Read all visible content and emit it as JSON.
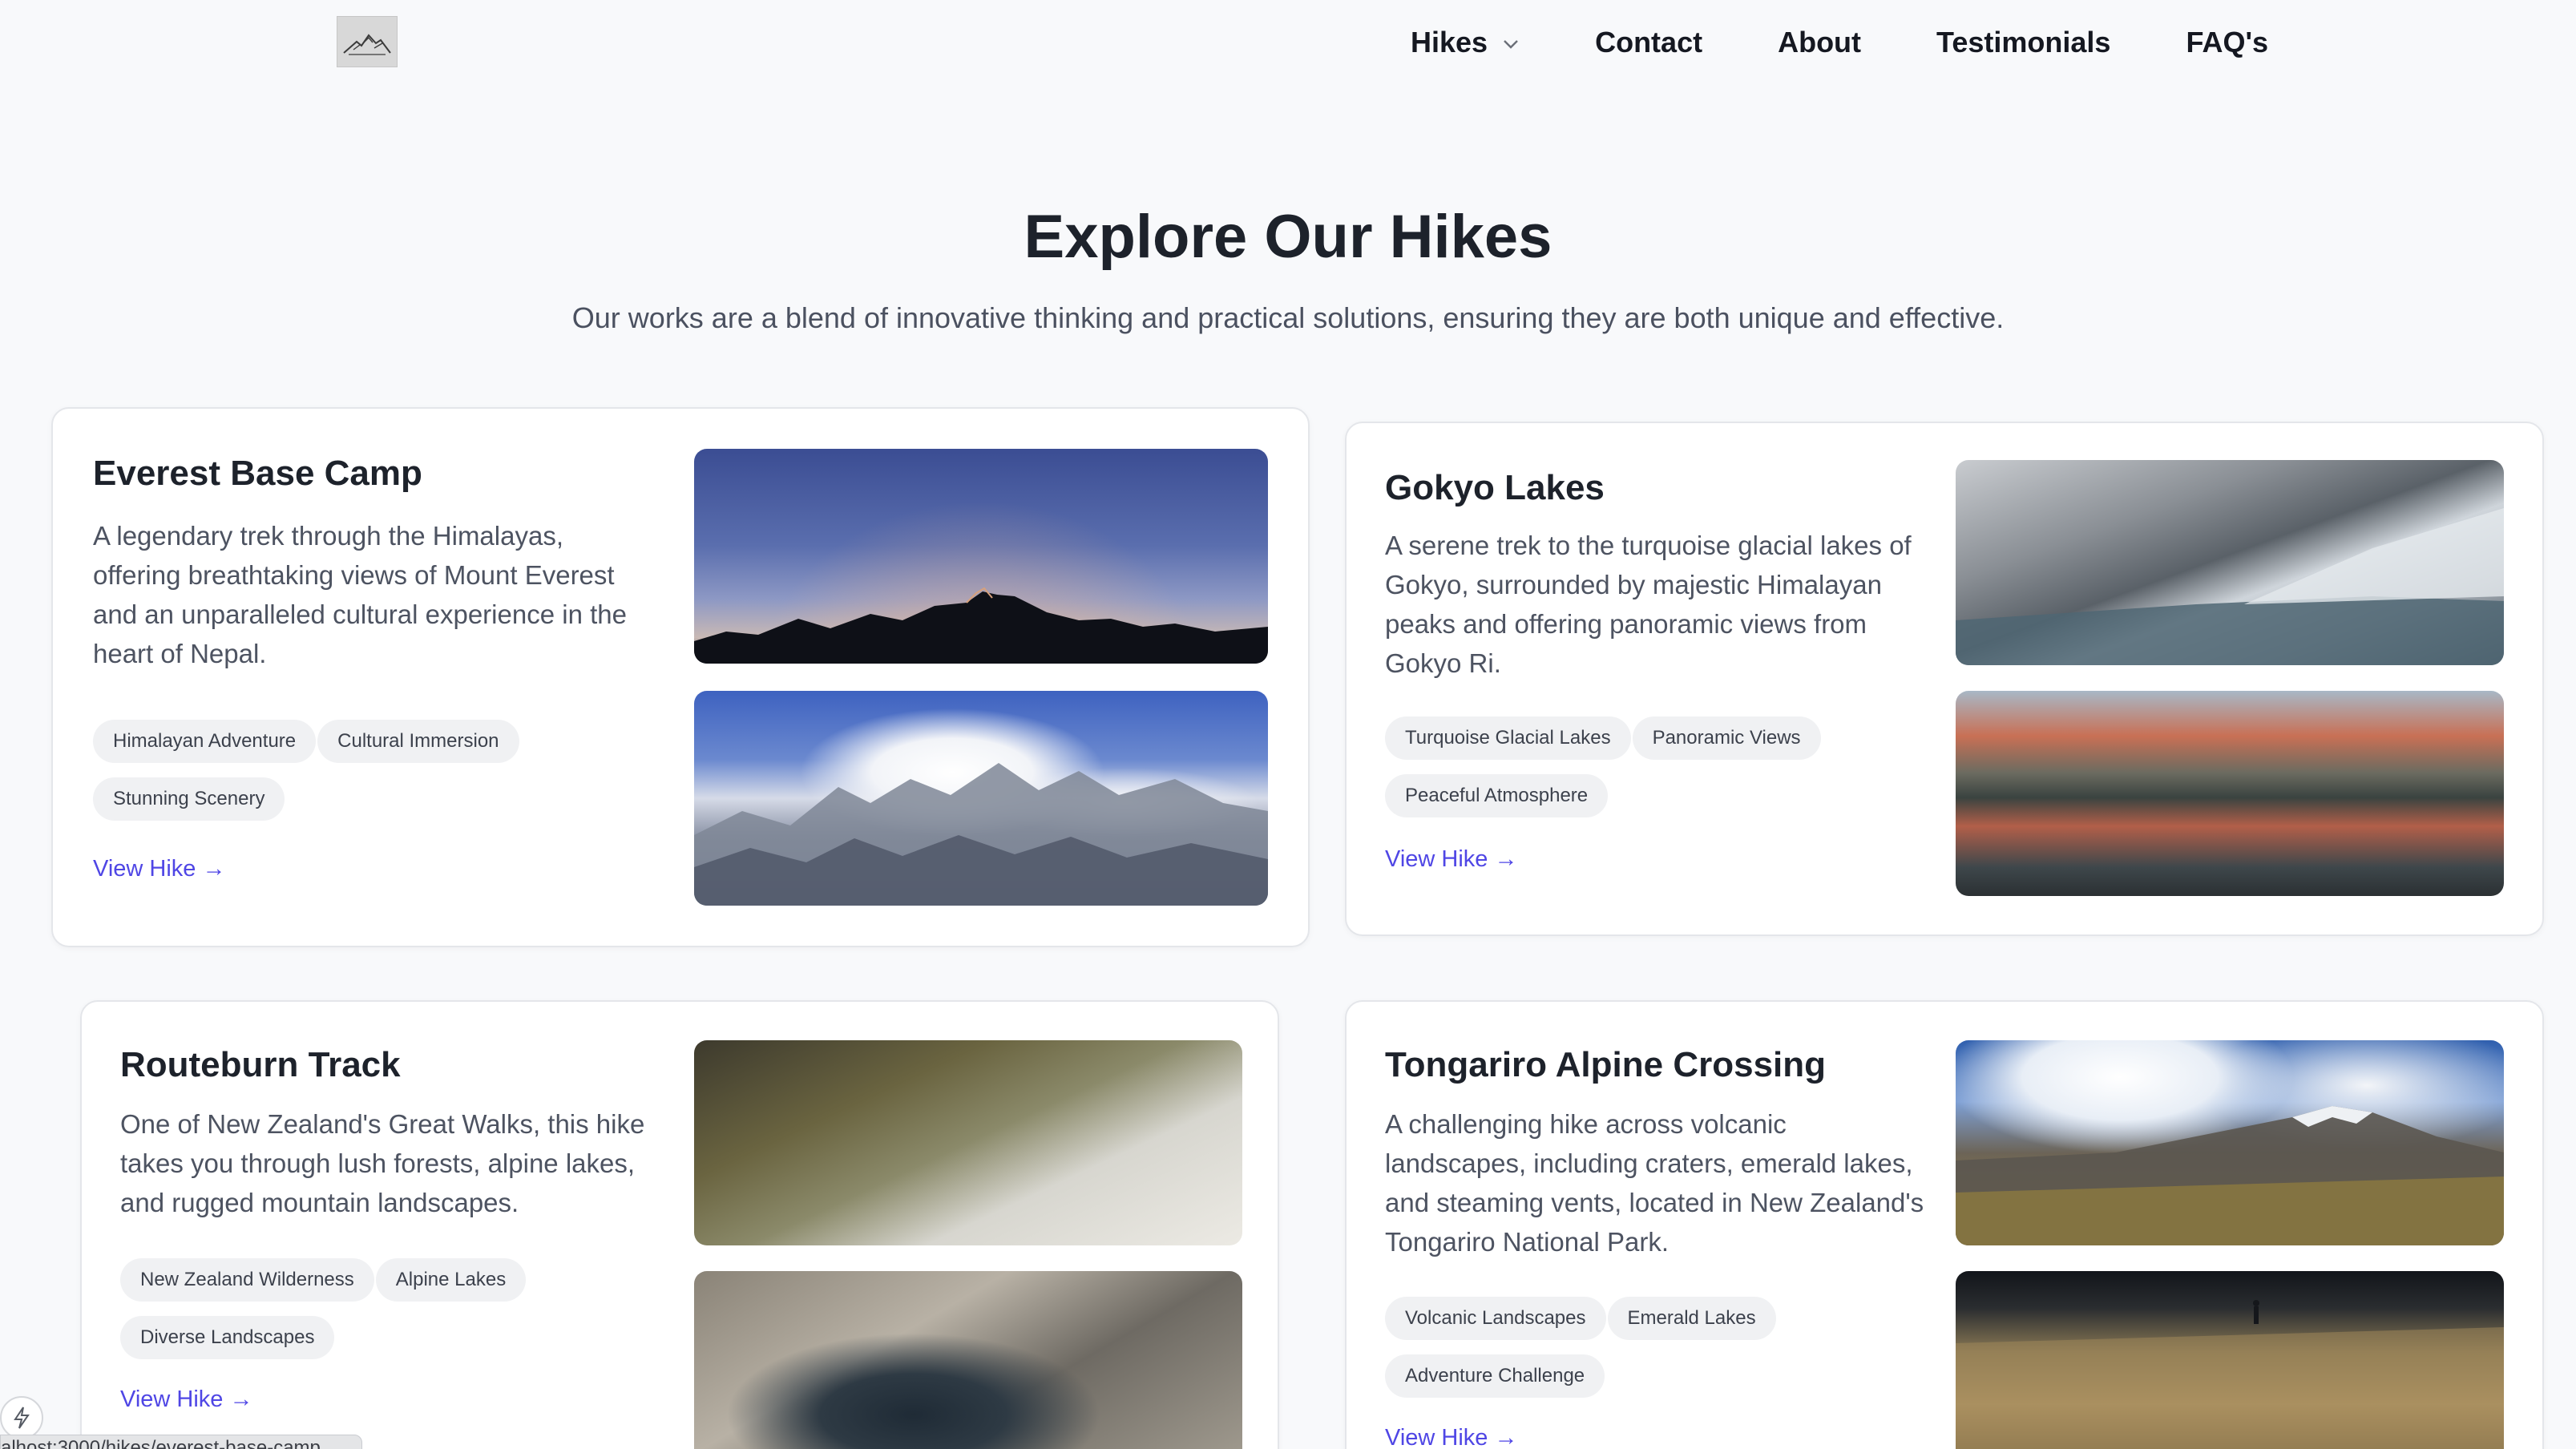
{
  "nav": {
    "items": [
      {
        "label": "Hikes",
        "has_dropdown": true
      },
      {
        "label": "Contact"
      },
      {
        "label": "About"
      },
      {
        "label": "Testimonials"
      },
      {
        "label": "FAQ's"
      }
    ]
  },
  "hero": {
    "title": "Explore Our Hikes",
    "subtitle": "Our works are a blend of innovative thinking and practical solutions, ensuring they are both unique and effective."
  },
  "hikes": [
    {
      "title": "Everest Base Camp",
      "description": "A legendary trek through the Himalayas, offering breathtaking views of Mount Everest and an unparalleled cultural experience in the heart of Nepal.",
      "tags": [
        "Himalayan Adventure",
        "Cultural Immersion",
        "Stunning Scenery"
      ],
      "link": "View Hike →"
    },
    {
      "title": "Gokyo Lakes",
      "description": "A serene trek to the turquoise glacial lakes of Gokyo, surrounded by majestic Himalayan peaks and offering panoramic views from Gokyo Ri.",
      "tags": [
        "Turquoise Glacial Lakes",
        "Panoramic Views",
        "Peaceful Atmosphere"
      ],
      "link": "View Hike →"
    },
    {
      "title": "Routeburn Track",
      "description": "One of New Zealand's Great Walks, this hike takes you through lush forests, alpine lakes, and rugged mountain landscapes.",
      "tags": [
        "New Zealand Wilderness",
        "Alpine Lakes",
        "Diverse Landscapes"
      ],
      "link": "View Hike →"
    },
    {
      "title": "Tongariro Alpine Crossing",
      "description": "A challenging hike across volcanic landscapes, including craters, emerald lakes, and steaming vents, located in New Zealand's Tongariro National Park.",
      "tags": [
        "Volcanic Landscapes",
        "Emerald Lakes",
        "Adventure Challenge"
      ],
      "link": "View Hike →"
    }
  ],
  "status_bar": {
    "url": "alhost:3000/hikes/everest-base-camp"
  },
  "colors": {
    "link": "#4f46e5",
    "page_bg": "#f8f9fb"
  }
}
